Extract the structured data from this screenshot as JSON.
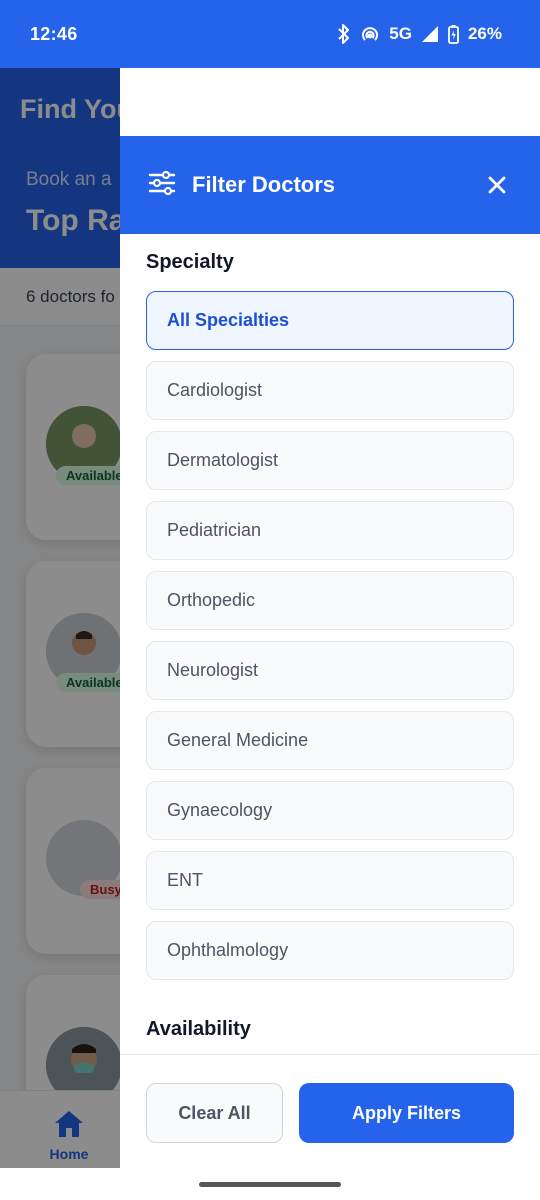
{
  "status_bar": {
    "time": "12:46",
    "network": "5G",
    "battery": "26%",
    "icons": [
      "bluetooth-icon",
      "hotspot-icon",
      "signal-icon",
      "battery-charging-icon"
    ]
  },
  "background_page": {
    "hero_title": "Find You",
    "hero_subtitle": "Book an a",
    "hero_heading": "Top Ra",
    "result_count": "6 doctors fo",
    "doctor_badges": [
      "Available",
      "Available",
      "Busy"
    ],
    "bottom_nav": {
      "home_label": "Home"
    }
  },
  "filter_drawer": {
    "title": "Filter Doctors",
    "specialty_section_title": "Specialty",
    "specialties": [
      "All Specialties",
      "Cardiologist",
      "Dermatologist",
      "Pediatrician",
      "Orthopedic",
      "Neurologist",
      "General Medicine",
      "Gynaecology",
      "ENT",
      "Ophthalmology"
    ],
    "selected_specialty": "All Specialties",
    "availability_section_title": "Availability",
    "clear_label": "Clear All",
    "apply_label": "Apply Filters"
  },
  "colors": {
    "primary": "#2563EB",
    "selected_bg": "#EFF6FF",
    "available_badge": "#DCFCE7",
    "busy_badge": "#FEE2E2"
  }
}
